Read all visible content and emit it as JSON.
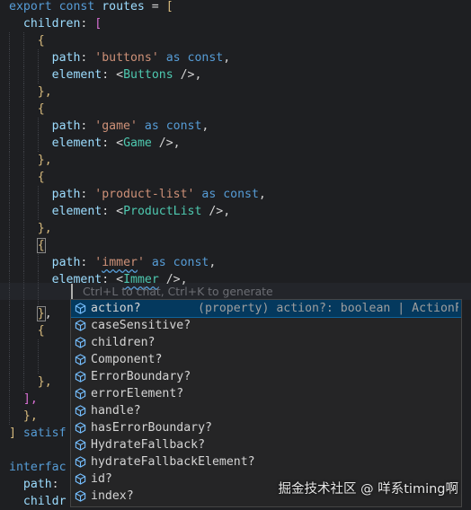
{
  "code": {
    "lines": [
      {
        "t": [
          [
            "export ",
            "kw"
          ],
          [
            "const ",
            "kw"
          ],
          [
            "routes",
            "var"
          ],
          [
            " = ",
            "plain"
          ],
          [
            "[",
            "brk"
          ]
        ]
      },
      {
        "t": [
          [
            "  children",
            "var"
          ],
          [
            ": ",
            "plain"
          ],
          [
            "[",
            "brc"
          ]
        ]
      },
      {
        "t": [
          [
            "    {",
            "brk"
          ]
        ]
      },
      {
        "t": [
          [
            "      path",
            "var"
          ],
          [
            ": ",
            "plain"
          ],
          [
            "'buttons'",
            "str"
          ],
          [
            " as ",
            "kw"
          ],
          [
            "const",
            "kw"
          ],
          [
            ",",
            "plain"
          ]
        ]
      },
      {
        "t": [
          [
            "      element",
            "var"
          ],
          [
            ": ",
            "plain"
          ],
          [
            "<",
            "tag"
          ],
          [
            "Buttons",
            "comp"
          ],
          [
            " />",
            "tag"
          ],
          [
            ",",
            "plain"
          ]
        ]
      },
      {
        "t": [
          [
            "    },",
            "brk"
          ]
        ]
      },
      {
        "t": [
          [
            "    {",
            "brk"
          ]
        ]
      },
      {
        "t": [
          [
            "      path",
            "var"
          ],
          [
            ": ",
            "plain"
          ],
          [
            "'game'",
            "str"
          ],
          [
            " as ",
            "kw"
          ],
          [
            "const",
            "kw"
          ],
          [
            ",",
            "plain"
          ]
        ]
      },
      {
        "t": [
          [
            "      element",
            "var"
          ],
          [
            ": ",
            "plain"
          ],
          [
            "<",
            "tag"
          ],
          [
            "Game",
            "comp"
          ],
          [
            " />",
            "tag"
          ],
          [
            ",",
            "plain"
          ]
        ]
      },
      {
        "t": [
          [
            "    },",
            "brk"
          ]
        ]
      },
      {
        "t": [
          [
            "    {",
            "brk"
          ]
        ]
      },
      {
        "t": [
          [
            "      path",
            "var"
          ],
          [
            ": ",
            "plain"
          ],
          [
            "'product-list'",
            "str"
          ],
          [
            " as ",
            "kw"
          ],
          [
            "const",
            "kw"
          ],
          [
            ",",
            "plain"
          ]
        ]
      },
      {
        "t": [
          [
            "      element",
            "var"
          ],
          [
            ": ",
            "plain"
          ],
          [
            "<",
            "tag"
          ],
          [
            "ProductList",
            "comp"
          ],
          [
            " />",
            "tag"
          ],
          [
            ",",
            "plain"
          ]
        ]
      },
      {
        "t": [
          [
            "    },",
            "brk"
          ]
        ]
      },
      {
        "t": [
          [
            "    {",
            "brkbox"
          ]
        ]
      },
      {
        "t": [
          [
            "      path",
            "var"
          ],
          [
            ": ",
            "plain"
          ],
          [
            "'",
            "str"
          ],
          [
            "immer",
            "strsq"
          ],
          [
            "'",
            "str"
          ],
          [
            " as ",
            "kw"
          ],
          [
            "const",
            "kw"
          ],
          [
            ",",
            "plain"
          ]
        ]
      },
      {
        "t": [
          [
            "      element",
            "var"
          ],
          [
            ": ",
            "plain"
          ],
          [
            "<",
            "tag"
          ],
          [
            "Immer",
            "compsq"
          ],
          [
            " />",
            "tag"
          ],
          [
            ",",
            "plain"
          ]
        ]
      },
      {
        "t": [
          [
            "",
            "plain"
          ]
        ]
      },
      {
        "t": [
          [
            "    }",
            "brkbox"
          ],
          [
            ",",
            "plain"
          ]
        ]
      },
      {
        "t": [
          [
            "    {",
            "brk"
          ]
        ]
      },
      {
        "t": [
          [
            "",
            "plain"
          ]
        ]
      },
      {
        "t": [
          [
            "",
            "plain"
          ]
        ]
      },
      {
        "t": [
          [
            "    },",
            "brk"
          ]
        ]
      },
      {
        "t": [
          [
            "  ],",
            "brc"
          ]
        ]
      },
      {
        "t": [
          [
            "  },",
            "brk"
          ]
        ]
      },
      {
        "t": [
          [
            "] ",
            "brk"
          ],
          [
            "satisf",
            "kw"
          ]
        ]
      },
      {
        "t": [
          [
            "",
            "plain"
          ]
        ]
      },
      {
        "t": [
          [
            "interfac",
            "kw"
          ]
        ]
      },
      {
        "t": [
          [
            "  path",
            "var"
          ],
          [
            ": ",
            "plain"
          ]
        ]
      },
      {
        "t": [
          [
            "  childr",
            "var"
          ]
        ]
      }
    ]
  },
  "inline_hint": "Ctrl+L to chat, Ctrl+K to generate",
  "suggest": {
    "items": [
      {
        "label": "action?",
        "detail": "(property) action?: boolean | ActionF…"
      },
      {
        "label": "caseSensitive?"
      },
      {
        "label": "children?"
      },
      {
        "label": "Component?"
      },
      {
        "label": "ErrorBoundary?"
      },
      {
        "label": "errorElement?"
      },
      {
        "label": "handle?"
      },
      {
        "label": "hasErrorBoundary?"
      },
      {
        "label": "HydrateFallback?"
      },
      {
        "label": "hydrateFallbackElement?"
      },
      {
        "label": "id?"
      },
      {
        "label": "index?"
      }
    ],
    "icon": "property-cube-icon",
    "accent": "#75beff"
  },
  "watermark": "掘金技术社区 @ 咩系timing啊"
}
